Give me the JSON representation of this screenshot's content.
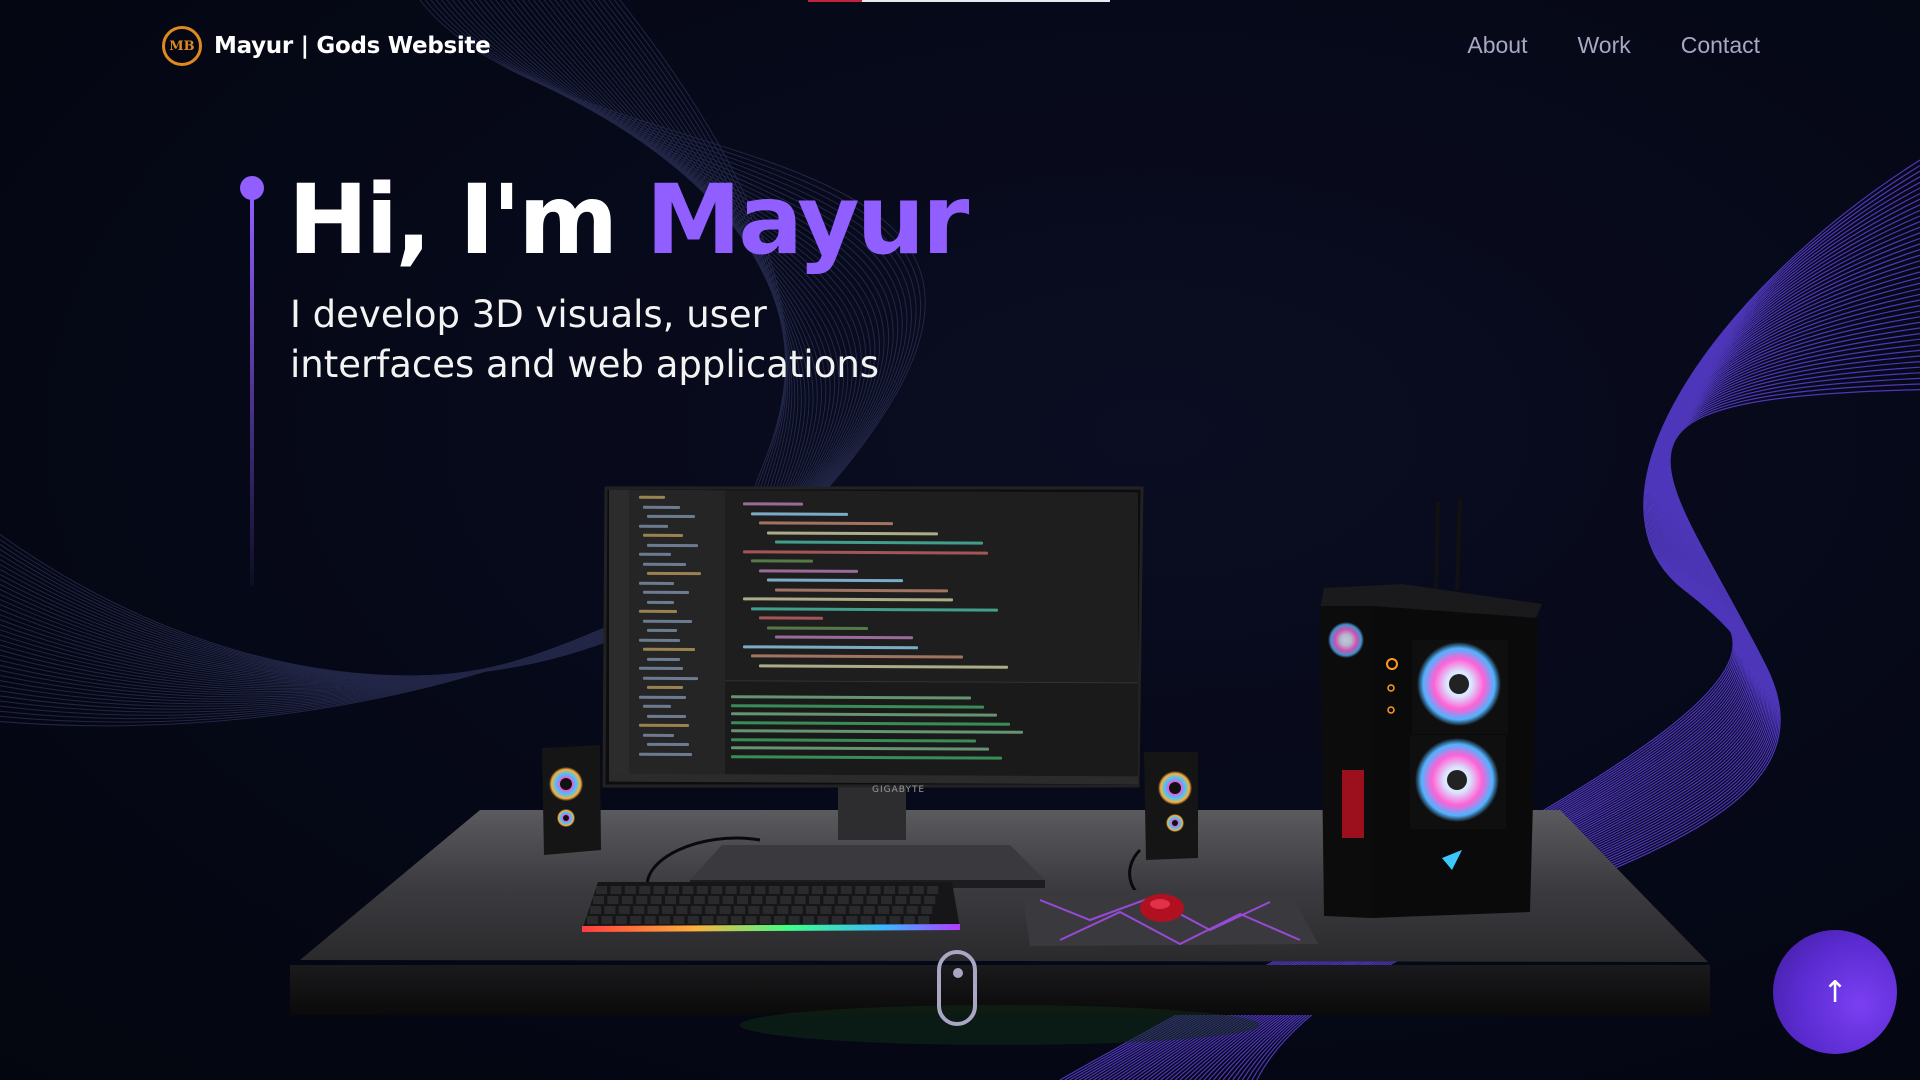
{
  "nav": {
    "logo_initials": "MB",
    "brand": "Mayur | Gods Website",
    "links": [
      "About",
      "Work",
      "Contact"
    ]
  },
  "hero": {
    "greeting": "Hi, I'm ",
    "name": "Mayur",
    "subtitle_line1": "I develop 3D visuals, user",
    "subtitle_line2": "interfaces and web applications"
  },
  "scene": {
    "monitor_brand": "GIGABYTE"
  },
  "back_to_top": {
    "icon": "arrow-up-icon",
    "glyph": "↑"
  },
  "scroll_indicator": {
    "icon": "mouse-scroll-icon"
  },
  "colors": {
    "accent": "#915eff",
    "background": "#050816",
    "nav_text": "#aaa6c3"
  }
}
